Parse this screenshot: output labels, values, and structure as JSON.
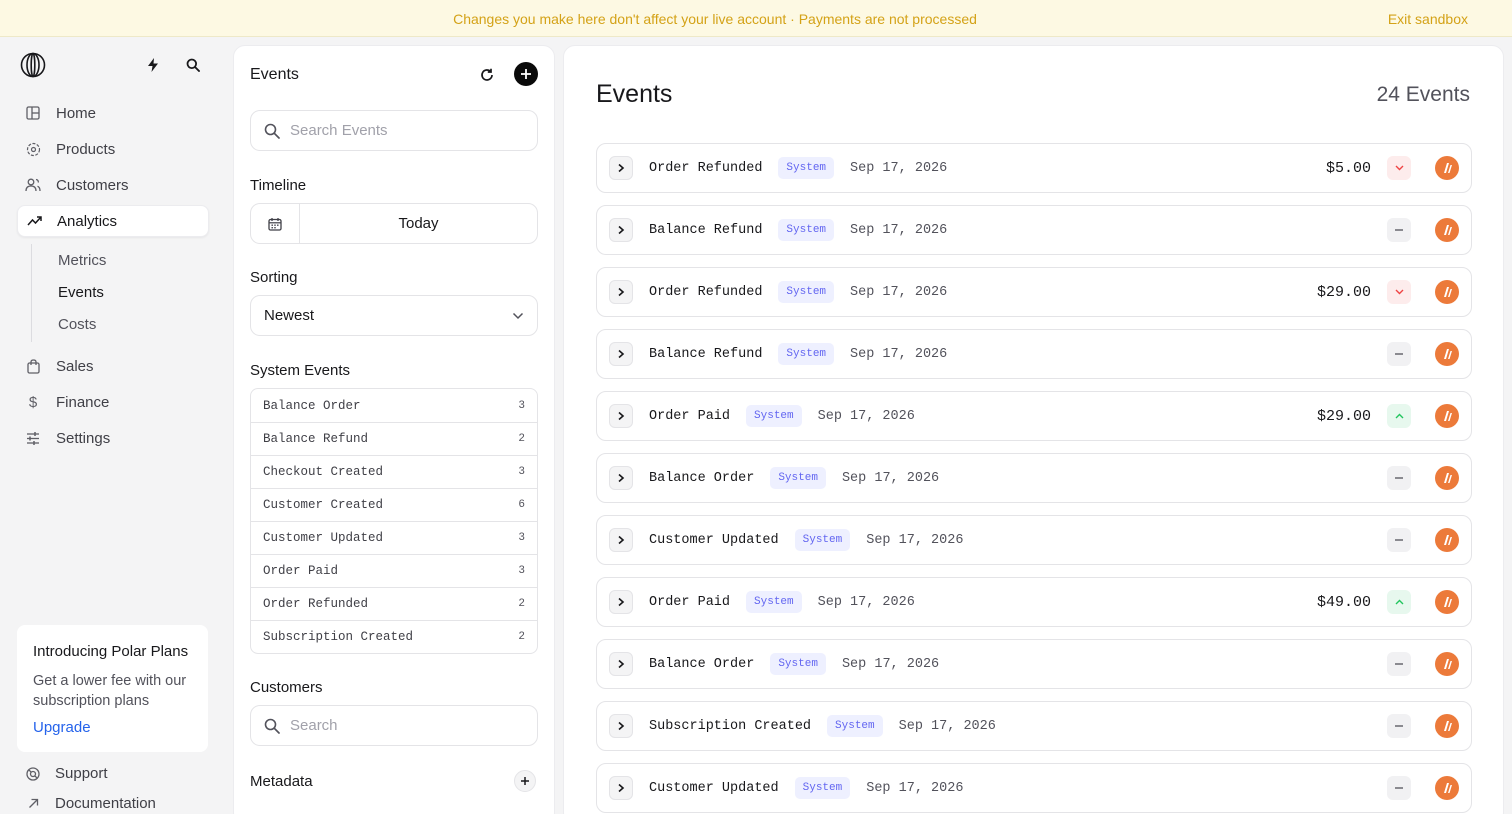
{
  "banner": {
    "message": "Changes you make here don't affect your live account · Payments are not processed",
    "exit_label": "Exit sandbox"
  },
  "sidebar": {
    "nav": [
      {
        "label": "Home",
        "icon": "home-icon"
      },
      {
        "label": "Products",
        "icon": "products-icon"
      },
      {
        "label": "Customers",
        "icon": "customers-icon"
      },
      {
        "label": "Analytics",
        "icon": "analytics-icon",
        "active": true
      }
    ],
    "sub_nav": [
      {
        "label": "Metrics"
      },
      {
        "label": "Events",
        "active": true
      },
      {
        "label": "Costs"
      }
    ],
    "nav2": [
      {
        "label": "Sales",
        "icon": "bag-icon"
      },
      {
        "label": "Finance",
        "icon": "dollar-icon"
      },
      {
        "label": "Settings",
        "icon": "sliders-icon"
      }
    ],
    "promo": {
      "title": "Introducing Polar Plans",
      "body": "Get a lower fee with our subscription plans",
      "link": "Upgrade"
    },
    "footer": [
      {
        "label": "Support",
        "icon": "support-icon"
      },
      {
        "label": "Documentation",
        "icon": "external-arrow-icon"
      }
    ]
  },
  "filters": {
    "title": "Events",
    "search_placeholder": "Search Events",
    "timeline_label": "Timeline",
    "timeline_value": "Today",
    "sorting_label": "Sorting",
    "sorting_value": "Newest",
    "system_events_label": "System Events",
    "system_events": [
      {
        "name": "Balance Order",
        "count": "3"
      },
      {
        "name": "Balance Refund",
        "count": "2"
      },
      {
        "name": "Checkout Created",
        "count": "3"
      },
      {
        "name": "Customer Created",
        "count": "6"
      },
      {
        "name": "Customer Updated",
        "count": "3"
      },
      {
        "name": "Order Paid",
        "count": "3"
      },
      {
        "name": "Order Refunded",
        "count": "2"
      },
      {
        "name": "Subscription Created",
        "count": "2"
      }
    ],
    "customers_label": "Customers",
    "customers_placeholder": "Search",
    "metadata_label": "Metadata"
  },
  "main": {
    "title": "Events",
    "count": "24 Events",
    "events": [
      {
        "name": "Order Refunded",
        "badge": "System",
        "date": "Sep 17, 2026",
        "amount": "$5.00",
        "trend": "down"
      },
      {
        "name": "Balance Refund",
        "badge": "System",
        "date": "Sep 17, 2026",
        "amount": "",
        "trend": "none"
      },
      {
        "name": "Order Refunded",
        "badge": "System",
        "date": "Sep 17, 2026",
        "amount": "$29.00",
        "trend": "down"
      },
      {
        "name": "Balance Refund",
        "badge": "System",
        "date": "Sep 17, 2026",
        "amount": "",
        "trend": "none"
      },
      {
        "name": "Order Paid",
        "badge": "System",
        "date": "Sep 17, 2026",
        "amount": "$29.00",
        "trend": "up"
      },
      {
        "name": "Balance Order",
        "badge": "System",
        "date": "Sep 17, 2026",
        "amount": "",
        "trend": "none"
      },
      {
        "name": "Customer Updated",
        "badge": "System",
        "date": "Sep 17, 2026",
        "amount": "",
        "trend": "none"
      },
      {
        "name": "Order Paid",
        "badge": "System",
        "date": "Sep 17, 2026",
        "amount": "$49.00",
        "trend": "up"
      },
      {
        "name": "Balance Order",
        "badge": "System",
        "date": "Sep 17, 2026",
        "amount": "",
        "trend": "none"
      },
      {
        "name": "Subscription Created",
        "badge": "System",
        "date": "Sep 17, 2026",
        "amount": "",
        "trend": "none"
      },
      {
        "name": "Customer Updated",
        "badge": "System",
        "date": "Sep 17, 2026",
        "amount": "",
        "trend": "none"
      }
    ]
  },
  "colors": {
    "banner_bg": "#fdf9e3",
    "banner_text": "#d4a217",
    "badge_text": "#6366f1",
    "badge_bg": "#eef0ff",
    "avatar": "#ec7a3a",
    "link": "#2563eb"
  }
}
